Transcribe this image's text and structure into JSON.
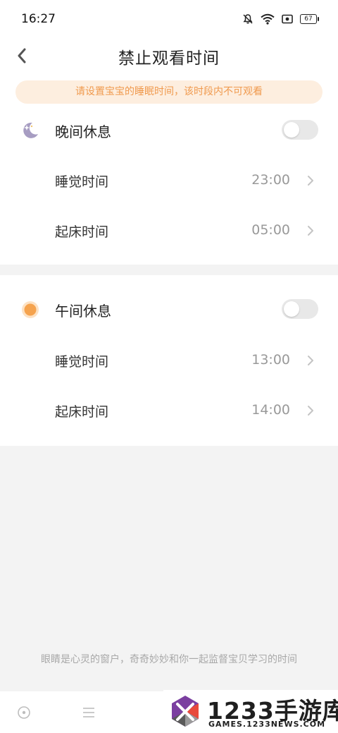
{
  "status_bar": {
    "time": "16:27",
    "battery_level": "67",
    "icons": [
      "mute-bell-icon",
      "wifi-icon",
      "screen-record-icon",
      "battery-icon"
    ]
  },
  "nav": {
    "title": "禁止观看时间",
    "back_icon": "chevron-left-icon"
  },
  "notice": {
    "text": "请设置宝宝的睡眠时间，该时段内不可观看",
    "bg_color": "#fdeedf",
    "text_color": "#f09a4e"
  },
  "night_rest": {
    "title": "晚间休息",
    "icon": "moon-icon",
    "enabled": false,
    "rows": [
      {
        "label": "睡觉时间",
        "value": "23:00"
      },
      {
        "label": "起床时间",
        "value": "05:00"
      }
    ]
  },
  "noon_rest": {
    "title": "午间休息",
    "icon": "sun-icon",
    "enabled": false,
    "rows": [
      {
        "label": "睡觉时间",
        "value": "13:00"
      },
      {
        "label": "起床时间",
        "value": "14:00"
      }
    ]
  },
  "footer": {
    "note": "眼睛是心灵的窗户，奇奇妙妙和你一起监督宝贝学习的时间"
  },
  "bottom_nav": {
    "icons": [
      "home-circle-icon",
      "menu-icon"
    ]
  },
  "watermark": {
    "brand": "1233手游库",
    "domain": "GAMES.1233NEWS.COM"
  },
  "colors": {
    "accent_orange": "#f09a4e",
    "toggle_off": "#e8e8e8",
    "moon_purple": "#9a8fb8",
    "sun_orange": "#f5a34e"
  }
}
